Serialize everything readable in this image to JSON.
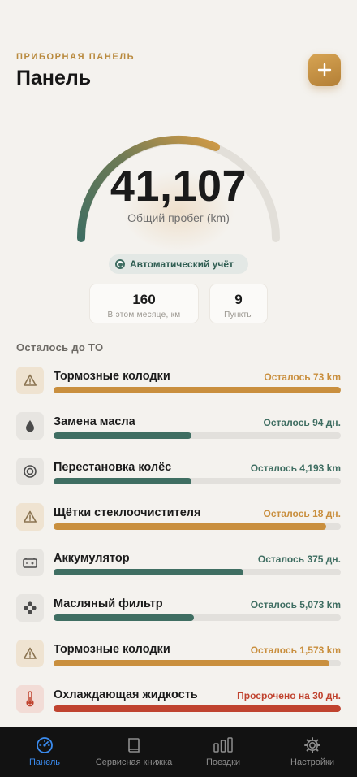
{
  "header": {
    "eyebrow": "ПРИБОРНАЯ ПАНЕЛЬ",
    "title": "Панель"
  },
  "odometer": {
    "value": "41,107",
    "label": "Общий пробег (km)"
  },
  "auto_tracking": "Автоматический учёт",
  "stats": [
    {
      "value": "160",
      "label": "В этом месяце, км"
    },
    {
      "value": "9",
      "label": "Пункты"
    }
  ],
  "section_title": "Осталось до ТО",
  "items": [
    {
      "name": "Тормозные колодки",
      "remaining": "Осталось 73 km",
      "progress": 1.0,
      "status": "warning",
      "icon": "warning-icon"
    },
    {
      "name": "Замена масла",
      "remaining": "Осталось 94 дн.",
      "progress": 0.48,
      "status": "ok",
      "icon": "oil-drop-icon"
    },
    {
      "name": "Перестановка колёс",
      "remaining": "Осталось 4,193 km",
      "progress": 0.48,
      "status": "ok",
      "icon": "tire-icon"
    },
    {
      "name": "Щётки стеклоочистителя",
      "remaining": "Осталось 18 дн.",
      "progress": 0.95,
      "status": "warning",
      "icon": "warning-icon"
    },
    {
      "name": "Аккумулятор",
      "remaining": "Осталось 375 дн.",
      "progress": 0.66,
      "status": "ok",
      "icon": "battery-icon"
    },
    {
      "name": "Масляный фильтр",
      "remaining": "Осталось 5,073 km",
      "progress": 0.49,
      "status": "ok",
      "icon": "filter-icon"
    },
    {
      "name": "Тормозные колодки",
      "remaining": "Осталось 1,573 km",
      "progress": 0.96,
      "status": "warning",
      "icon": "warning-icon"
    },
    {
      "name": "Охлаждающая жидкость",
      "remaining": "Просрочено на 30 дн.",
      "progress": 1.0,
      "status": "danger",
      "icon": "thermometer-icon"
    }
  ],
  "tabs": [
    {
      "label": "Панель",
      "icon": "gauge-icon",
      "active": true
    },
    {
      "label": "Сервисная книжка",
      "icon": "book-icon",
      "active": false
    },
    {
      "label": "Поездки",
      "icon": "bar-chart-icon",
      "active": false
    },
    {
      "label": "Настройки",
      "icon": "gear-icon",
      "active": false
    }
  ],
  "colors": {
    "accent": "#c98f3e",
    "ok": "#3f6e62",
    "warning": "#c98f3e",
    "danger": "#c0432f",
    "tab_active": "#3b8cf0"
  }
}
